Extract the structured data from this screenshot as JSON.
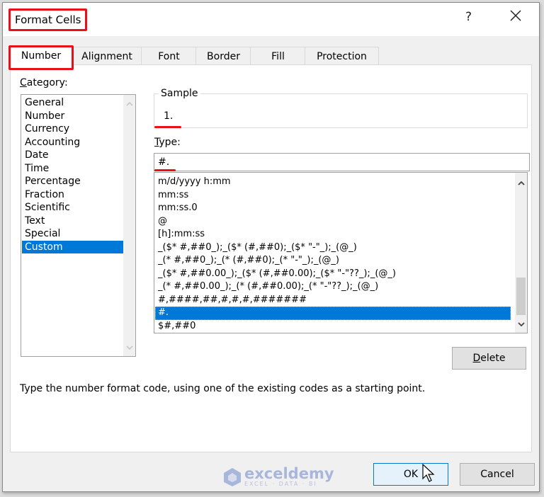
{
  "window": {
    "title": "Format Cells",
    "help_label": "?",
    "close_icon": "close-icon"
  },
  "tabs": [
    {
      "label": "Number",
      "active": true
    },
    {
      "label": "Alignment",
      "active": false
    },
    {
      "label": "Font",
      "active": false
    },
    {
      "label": "Border",
      "active": false
    },
    {
      "label": "Fill",
      "active": false
    },
    {
      "label": "Protection",
      "active": false
    }
  ],
  "category": {
    "label_underlined": "C",
    "label_rest": "ategory:",
    "items": [
      "General",
      "Number",
      "Currency",
      "Accounting",
      "Date",
      "Time",
      "Percentage",
      "Fraction",
      "Scientific",
      "Text",
      "Special",
      "Custom"
    ],
    "selected": "Custom"
  },
  "sample": {
    "legend": "Sample",
    "value": "1."
  },
  "type": {
    "label_underlined": "T",
    "label_rest": "ype:",
    "value": "#.",
    "items": [
      "m/d/yyyy h:mm",
      "mm:ss",
      "mm:ss.0",
      "@",
      "[h]:mm:ss",
      "_($* #,##0_);_($* (#,##0);_($* \"-\"_);_(@_)",
      "_(* #,##0_);_(* (#,##0);_(* \"-\"_);_(@_)",
      "_($* #,##0.00_);_($* (#,##0.00);_($* \"-\"??_);_(@_)",
      "_(* #,##0.00_);_(* (#,##0.00);_(* \"-\"??_);_(@_)",
      "#,####,##,#,#,#,#######",
      "#.",
      "$#,##0"
    ],
    "selected": "#."
  },
  "buttons": {
    "delete_underlined": "D",
    "delete_rest": "elete",
    "ok": "OK",
    "cancel": "Cancel"
  },
  "description": "Type the number format code, using one of the existing codes as a starting point.",
  "watermark": {
    "brand": "exceldemy",
    "tagline": "EXCEL · DATA · BI"
  },
  "colors": {
    "selection": "#0078d7",
    "highlight_annotation": "#e8111a"
  }
}
